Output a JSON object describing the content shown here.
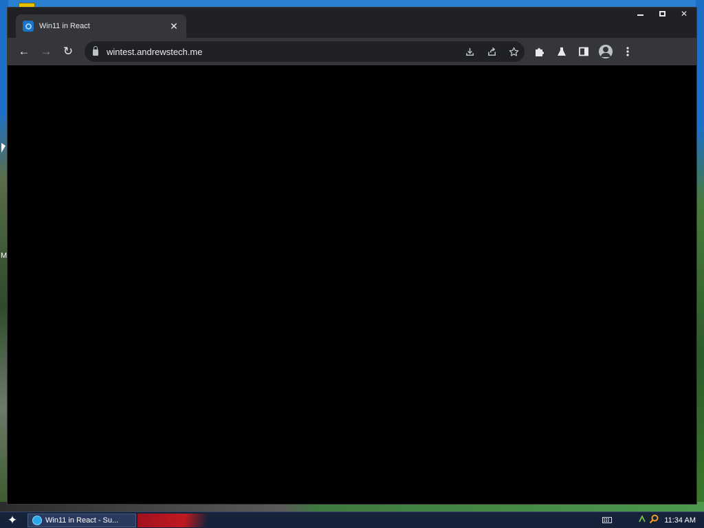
{
  "desktop": {
    "edge_letter": "M"
  },
  "browser": {
    "tab": {
      "title": "Win11 in React",
      "close_glyph": "✕",
      "favicon": "win11-logo-icon"
    },
    "window_controls": {
      "minimize": "minimize-icon",
      "maximize": "maximize-icon",
      "close": "✕"
    },
    "toolbar": {
      "back": "←",
      "forward": "→",
      "reload": "↻",
      "url": "wintest.andrewstech.me",
      "omnibox_icons": [
        "install-icon",
        "share-icon",
        "bookmark-star-icon"
      ],
      "right_icons": [
        "extensions-icon",
        "labs-flask-icon",
        "side-panel-icon",
        "profile-icon",
        "menu-icon"
      ]
    },
    "page_background": "#000000"
  },
  "taskbar": {
    "start_glyph": "✦",
    "task_item_label": "Win11 in React - Su...",
    "clock": "11:34 AM"
  },
  "colors": {
    "chrome_dark": "#202124",
    "chrome_toolbar": "#35363a",
    "taskbar": "#16223a"
  }
}
